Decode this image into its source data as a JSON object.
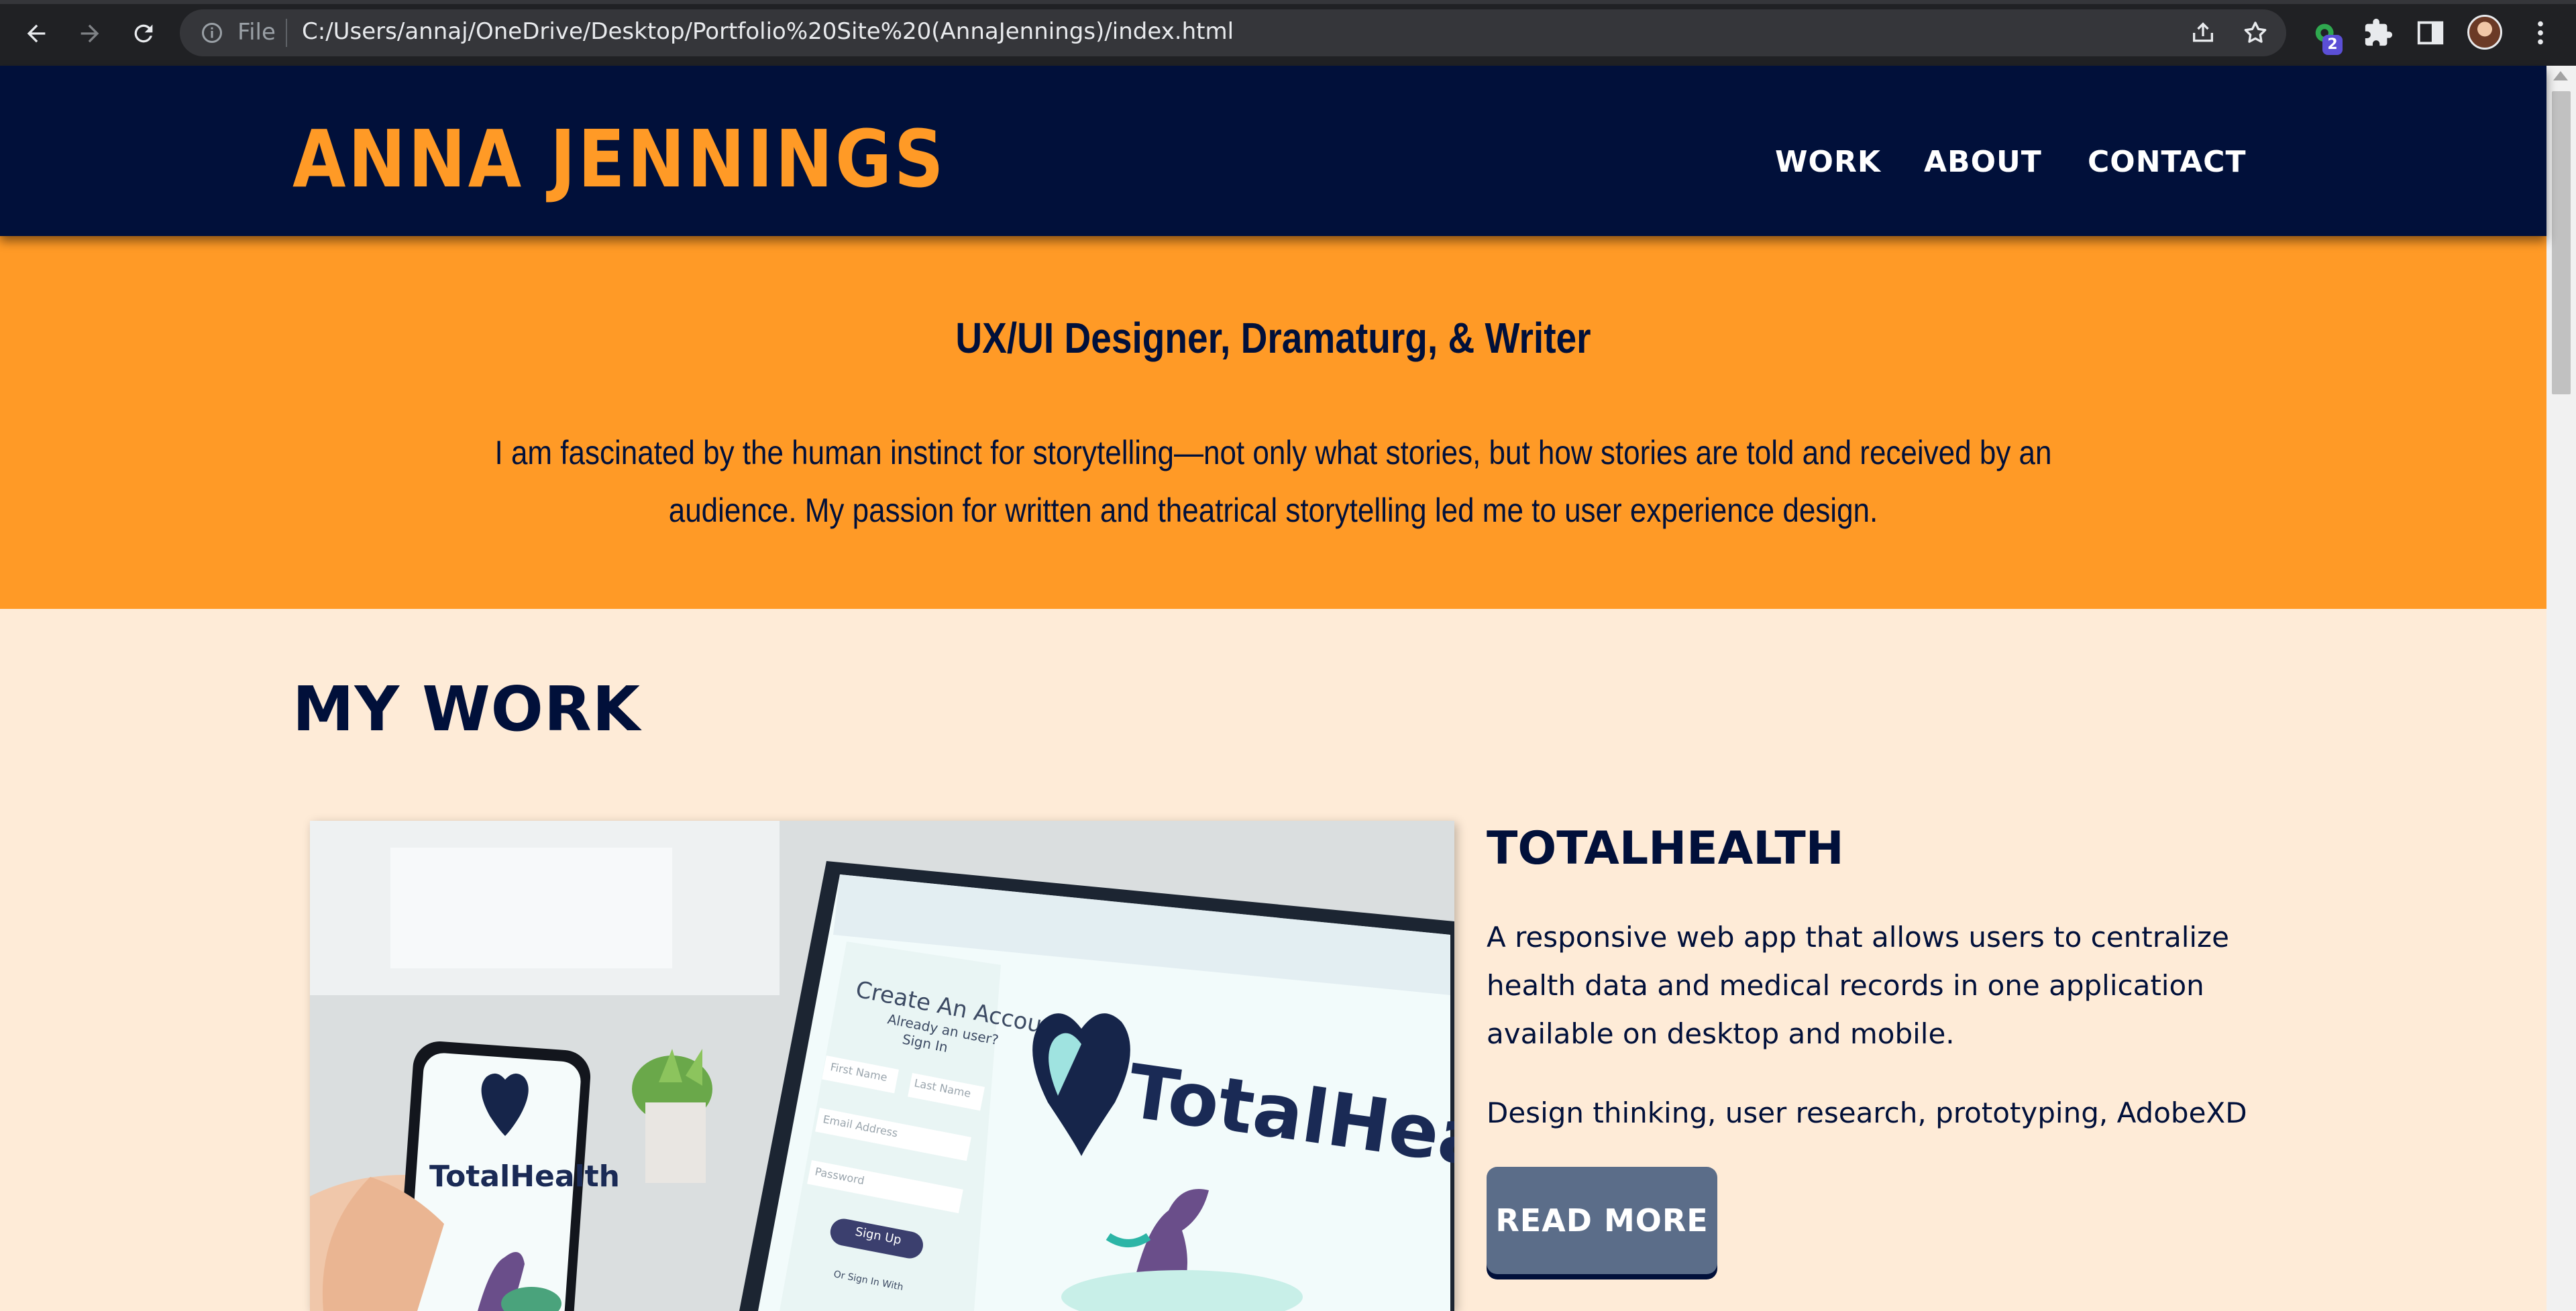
{
  "browser": {
    "file_label": "File",
    "url": "C:/Users/annaj/OneDrive/Desktop/Portfolio%20Site%20(AnnaJennings)/index.html",
    "extension_badge": "2",
    "icons": [
      "back-icon",
      "forward-icon",
      "reload-icon",
      "info-icon",
      "share-icon",
      "star-icon",
      "extension-icon",
      "puzzle-icon",
      "side-panel-icon",
      "avatar",
      "menu-icon"
    ]
  },
  "header": {
    "logo": "ANNA JENNINGS",
    "nav": [
      "WORK",
      "ABOUT",
      "CONTACT"
    ]
  },
  "hero": {
    "title": "UX/UI Designer, Dramaturg, & Writer",
    "body": "I am fascinated by the human instinct for storytelling—not only what stories, but how stories are told and received by an audience. My passion for written and theatrical storytelling led me to user experience design."
  },
  "work": {
    "section_title": "MY WORK",
    "project": {
      "title": "TOTALHEALTH",
      "description": "A responsive web app that allows users to centralize health data and medical records in one application available on desktop and mobile.",
      "skills": "Design thinking, user research, prototyping, AdobeXD",
      "button": "READ MORE",
      "image_texts": {
        "create_account": "Create An Account",
        "already_user": "Already an user?",
        "sign_in": "Sign In",
        "first_name": "First Name",
        "last_name": "Last Name",
        "email": "Email Address",
        "password": "Password",
        "sign_up": "Sign Up",
        "sign_in_with": "Or Sign In With",
        "brand": "TotalHealth"
      }
    }
  },
  "colors": {
    "navy": "#01103a",
    "orange": "#ff9a26",
    "cream": "#feebd7",
    "button": "#5b6d89"
  }
}
